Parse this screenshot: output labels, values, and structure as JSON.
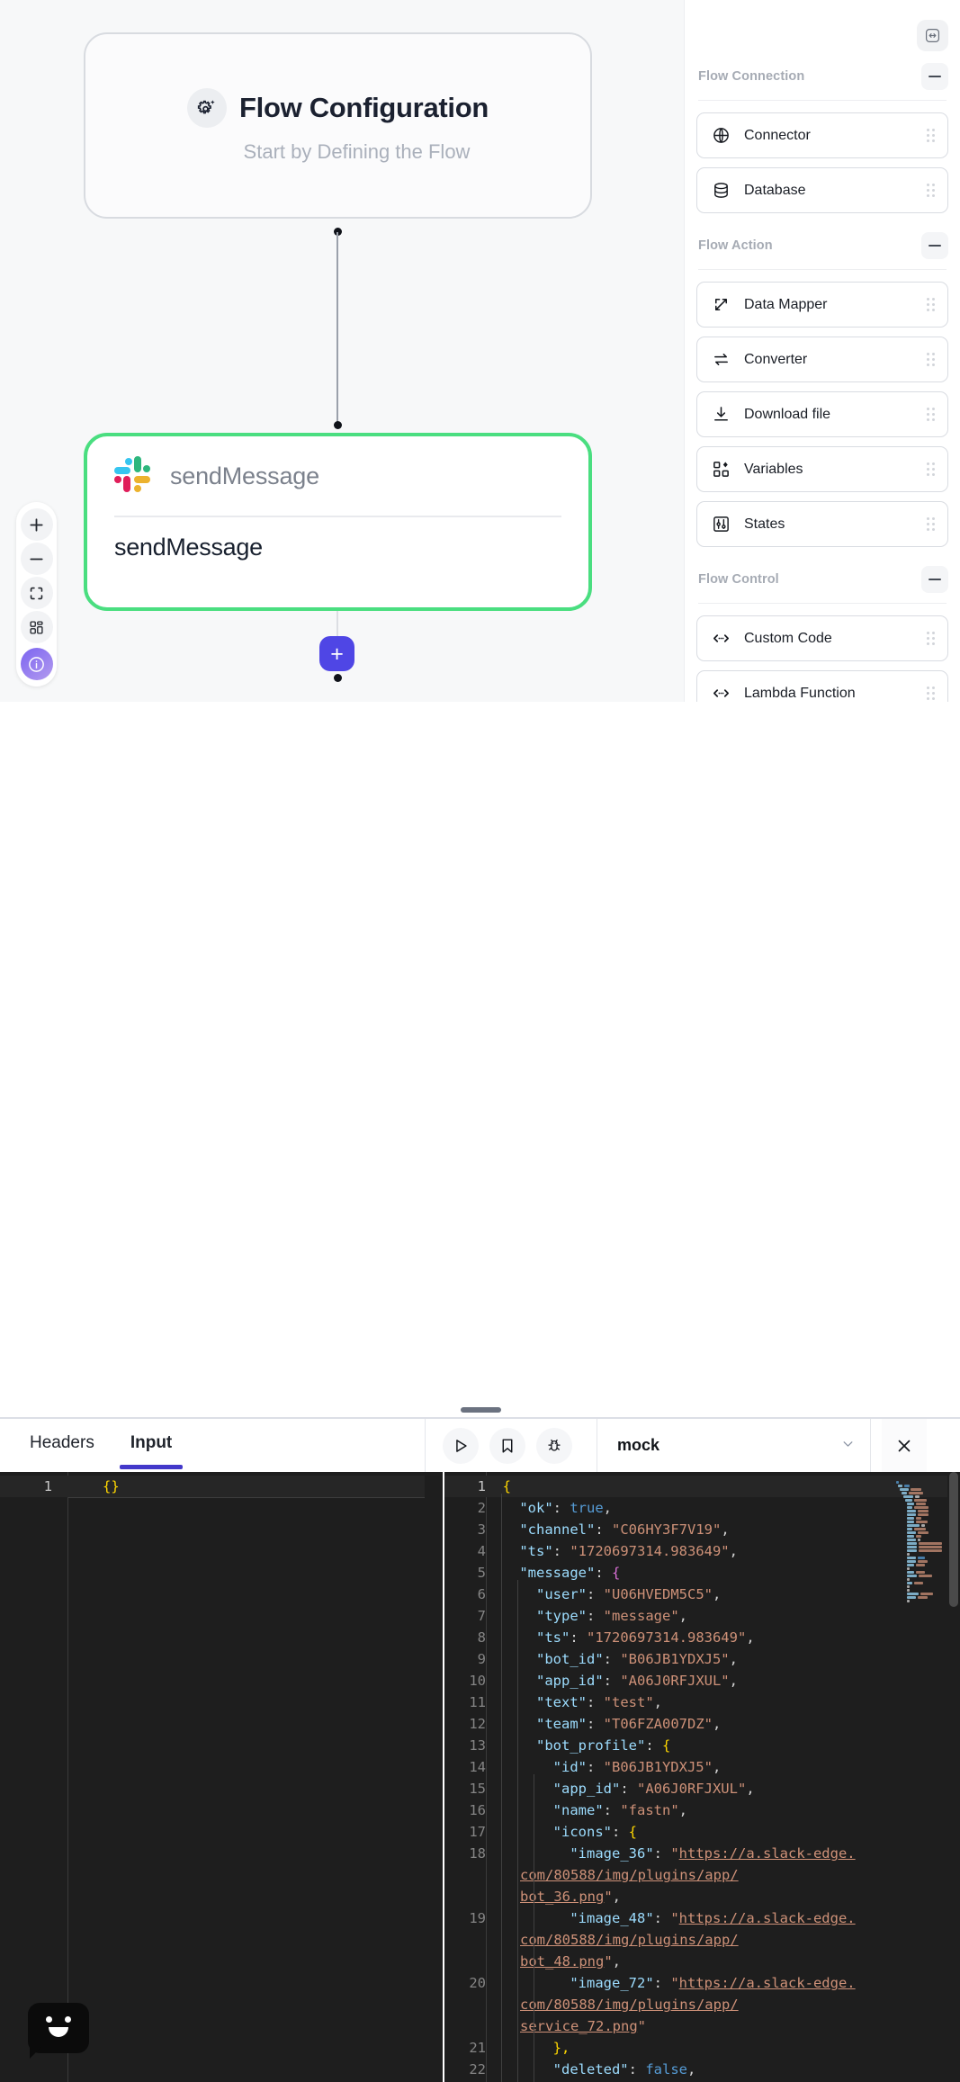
{
  "canvas": {
    "flow_config": {
      "title": "Flow Configuration",
      "subtitle": "Start by Defining the Flow",
      "icon": "gear-sparkle-icon"
    },
    "send_node": {
      "connector_name": "sendMessage",
      "node_label": "sendMessage",
      "icon": "slack-logo",
      "selected_color": "#4ade80"
    },
    "add_button_label": "+",
    "zoom_controls": [
      {
        "name": "zoom-in",
        "glyph": "+"
      },
      {
        "name": "zoom-out",
        "glyph": "−"
      },
      {
        "name": "fit-view",
        "glyph": "fit-icon"
      },
      {
        "name": "toggle-minimap",
        "glyph": "grid-icon"
      },
      {
        "name": "info",
        "glyph": "info-icon"
      }
    ]
  },
  "palette": {
    "expand_button": "expand-horizontal-icon",
    "groups": [
      {
        "title": "Flow Connection",
        "collapse_label": "—",
        "items": [
          {
            "label": "Connector",
            "icon": "globe-icon"
          },
          {
            "label": "Database",
            "icon": "database-icon"
          }
        ]
      },
      {
        "title": "Flow Action",
        "collapse_label": "—",
        "items": [
          {
            "label": "Data Mapper",
            "icon": "data-mapper-icon"
          },
          {
            "label": "Converter",
            "icon": "converter-icon"
          },
          {
            "label": "Download file",
            "icon": "download-icon"
          },
          {
            "label": "Variables",
            "icon": "variables-icon"
          },
          {
            "label": "States",
            "icon": "states-icon"
          }
        ]
      },
      {
        "title": "Flow Control",
        "collapse_label": "—",
        "items": [
          {
            "label": "Custom Code",
            "icon": "code-icon"
          },
          {
            "label": "Lambda Function",
            "icon": "code-icon"
          }
        ]
      }
    ]
  },
  "bottom_panel": {
    "tabs": [
      {
        "label": "Headers",
        "active": false
      },
      {
        "label": "Input",
        "active": true
      }
    ],
    "toolbar": [
      {
        "name": "run-button",
        "icon": "play-icon"
      },
      {
        "name": "bookmark-button",
        "icon": "bookmark-icon"
      },
      {
        "name": "debug-button",
        "icon": "bug-icon"
      }
    ],
    "mock_select": {
      "value": "mock",
      "chevron": "chevron-down-icon"
    },
    "close_label": "✕",
    "input_editor": {
      "lines": [
        {
          "no": "1",
          "text": "{}"
        }
      ]
    },
    "output_editor": {
      "lines": [
        {
          "no": "1",
          "indent": 0,
          "text": "{"
        },
        {
          "no": "2",
          "indent": 1,
          "key": "ok",
          "value": "true",
          "vtype": "bool",
          "trail": ","
        },
        {
          "no": "3",
          "indent": 1,
          "key": "channel",
          "value": "\"C06HY3F7V19\"",
          "vtype": "string",
          "trail": ","
        },
        {
          "no": "4",
          "indent": 1,
          "key": "ts",
          "value": "\"1720697314.983649\"",
          "vtype": "string",
          "trail": ","
        },
        {
          "no": "5",
          "indent": 1,
          "key": "message",
          "value": "{",
          "vtype": "brace2",
          "trail": ""
        },
        {
          "no": "6",
          "indent": 2,
          "key": "user",
          "value": "\"U06HVEDM5C5\"",
          "vtype": "string",
          "trail": ","
        },
        {
          "no": "7",
          "indent": 2,
          "key": "type",
          "value": "\"message\"",
          "vtype": "string",
          "trail": ","
        },
        {
          "no": "8",
          "indent": 2,
          "key": "ts",
          "value": "\"1720697314.983649\"",
          "vtype": "string",
          "trail": ","
        },
        {
          "no": "9",
          "indent": 2,
          "key": "bot_id",
          "value": "\"B06JB1YDXJ5\"",
          "vtype": "string",
          "trail": ","
        },
        {
          "no": "10",
          "indent": 2,
          "key": "app_id",
          "value": "\"A06J0RFJXUL\"",
          "vtype": "string",
          "trail": ","
        },
        {
          "no": "11",
          "indent": 2,
          "key": "text",
          "value": "\"test\"",
          "vtype": "string",
          "trail": ","
        },
        {
          "no": "12",
          "indent": 2,
          "key": "team",
          "value": "\"T06FZA007DZ\"",
          "vtype": "string",
          "trail": ","
        },
        {
          "no": "13",
          "indent": 2,
          "key": "bot_profile",
          "value": "{",
          "vtype": "brace1",
          "trail": ""
        },
        {
          "no": "14",
          "indent": 3,
          "key": "id",
          "value": "\"B06JB1YDXJ5\"",
          "vtype": "string",
          "trail": ","
        },
        {
          "no": "15",
          "indent": 3,
          "key": "app_id",
          "value": "\"A06J0RFJXUL\"",
          "vtype": "string",
          "trail": ","
        },
        {
          "no": "16",
          "indent": 3,
          "key": "name",
          "value": "\"fastn\"",
          "vtype": "string",
          "trail": ","
        },
        {
          "no": "17",
          "indent": 3,
          "key": "icons",
          "value": "{",
          "vtype": "brace1",
          "trail": ""
        },
        {
          "no": "18",
          "indent": 4,
          "key": "image_36",
          "url": "https://a.slack-edge.com/80588/img/plugins/app/bot_36.png",
          "vtype": "url",
          "trail": ","
        },
        {
          "no": "19",
          "indent": 4,
          "key": "image_48",
          "url": "https://a.slack-edge.com/80588/img/plugins/app/bot_48.png",
          "vtype": "url",
          "trail": ","
        },
        {
          "no": "20",
          "indent": 4,
          "key": "image_72",
          "url": "https://a.slack-edge.com/80588/img/plugins/app/service_72.png",
          "vtype": "url",
          "trail": ""
        },
        {
          "no": "21",
          "indent": 3,
          "text": "},",
          "vtype": "closebrace"
        },
        {
          "no": "22",
          "indent": 3,
          "key": "deleted",
          "value": "false",
          "vtype": "bool",
          "trail": ","
        }
      ]
    }
  },
  "chat_widget": {
    "icon": "smiley-chat-icon"
  },
  "colors": {
    "accent": "#4338ca",
    "add_button": "#4f46e5",
    "node_selected": "#4ade80",
    "canvas_bg": "#f7f8f9",
    "editor_bg": "#1e1e1e"
  }
}
